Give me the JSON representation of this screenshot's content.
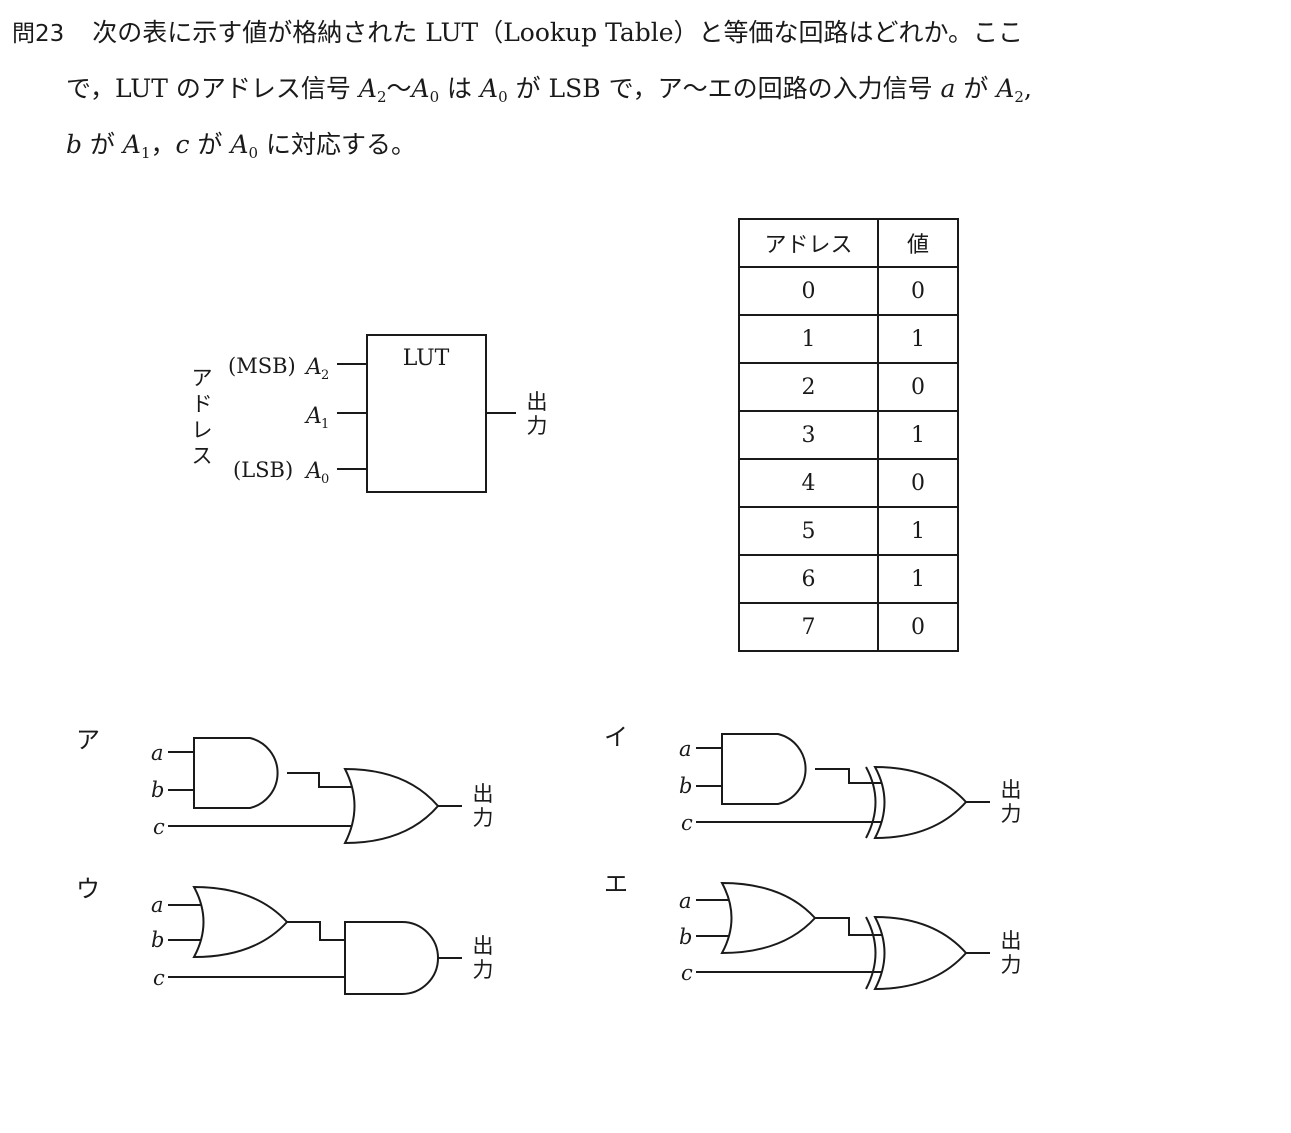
{
  "question": {
    "number": "問23",
    "line1": "次の表に示す値が格納された LUT（Lookup Table）と等価な回路はどれか。ここ",
    "line2": {
      "p1": "で，LUT のアドレス信号 ",
      "a": "A",
      "s2": "2",
      "tilde": "〜",
      "s0": "0",
      "p2": " は ",
      "p3": " が LSB で，ア〜エの回路の入力信号 ",
      "va": "a",
      "p4": " が ",
      "p5": ","
    },
    "line3": {
      "vb": "b",
      "p1": " が ",
      "s1": "1",
      "p2": "，",
      "vc": "c",
      "p3": " に対応する。"
    }
  },
  "lut_diagram": {
    "block_label": "LUT",
    "side_label": [
      "ア",
      "ド",
      "レ",
      "ス"
    ],
    "msb": "(MSB)",
    "lsb": "(LSB)",
    "A": "A",
    "sub2": "2",
    "sub1": "1",
    "sub0": "0",
    "output": [
      "出",
      "力"
    ]
  },
  "table": {
    "headers": [
      "アドレス",
      "値"
    ],
    "rows": [
      [
        "0",
        "0"
      ],
      [
        "1",
        "1"
      ],
      [
        "2",
        "0"
      ],
      [
        "3",
        "1"
      ],
      [
        "4",
        "0"
      ],
      [
        "5",
        "1"
      ],
      [
        "6",
        "1"
      ],
      [
        "7",
        "0"
      ]
    ]
  },
  "options": {
    "a": {
      "label": "ア"
    },
    "i": {
      "label": "イ"
    },
    "u": {
      "label": "ウ"
    },
    "e": {
      "label": "エ"
    },
    "inputs": [
      "a",
      "b",
      "c"
    ],
    "output": [
      "出",
      "力"
    ]
  }
}
